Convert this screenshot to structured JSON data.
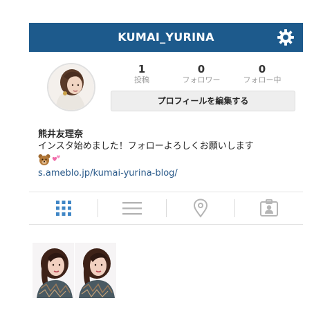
{
  "header": {
    "title": "KUMAI_YURINA",
    "settings_icon": "gear-icon",
    "background": "#1d5a8c"
  },
  "profile": {
    "stats": [
      {
        "value": "1",
        "label": "投稿"
      },
      {
        "value": "0",
        "label": "フォロワー"
      },
      {
        "value": "0",
        "label": "フォロー中"
      }
    ],
    "edit_button_label": "プロフィールを編集する",
    "name": "熊井友理奈",
    "bio": "インスタ始めました！フォローよろしくお願いします",
    "bio_emojis": [
      "bear-face-icon",
      "two-hearts-icon"
    ],
    "link": "s.ameblo.jp/kumai-yurina-blog/"
  },
  "tabs": [
    {
      "name": "grid-view",
      "icon": "grid-icon",
      "active": true
    },
    {
      "name": "list-view",
      "icon": "list-icon",
      "active": false
    },
    {
      "name": "location-view",
      "icon": "location-pin-icon",
      "active": false
    },
    {
      "name": "tagged-view",
      "icon": "person-tag-icon",
      "active": false
    }
  ],
  "posts": {
    "count": 1
  },
  "colors": {
    "accent": "#3f86c6",
    "link": "#2a5a8a",
    "inactive_icon": "#b5b5b5"
  }
}
